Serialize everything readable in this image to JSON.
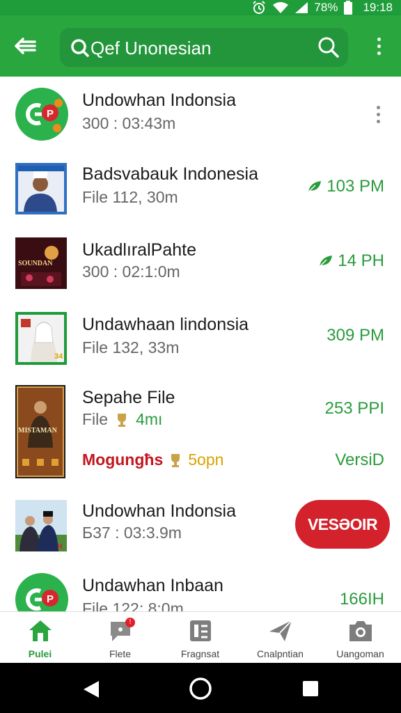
{
  "status_bar": {
    "battery": "78%",
    "time": "19:18"
  },
  "app_bar": {
    "search_text": "Qef Unonesian"
  },
  "list": [
    {
      "title": "Undowhan Indonsia",
      "subtitle": "300 : 03:43m",
      "trailing": ""
    },
    {
      "title": "Badsvabauk Indonesia",
      "subtitle": "File 112, 30m",
      "trailing": "103 PM"
    },
    {
      "title": "UkadlıralPahte",
      "subtitle": "300 : 02:1:0m",
      "trailing": "14 PH",
      "thumb_text": "SOUNDAN"
    },
    {
      "title": "Undawhaan lindonsia",
      "subtitle": "File 132, 33m",
      "trailing": "309 PM",
      "thumb_text": "34"
    },
    {
      "title": "Sepahe File",
      "subtitle_prefix": "File",
      "subtitle_value": "4mı",
      "trailing": "253 PPI",
      "extra_red": "Mogungħs",
      "extra_orange": "5opn",
      "extra_right": "VersiD",
      "thumb_text": "MISTAMAN"
    },
    {
      "title": "Undowhan Indonsia",
      "subtitle": "Б37 : 03:3.9m",
      "button": "VESƏOIR"
    },
    {
      "title": "Undawhan Inbaan",
      "subtitle": "File 122: 8:0m",
      "trailing": "166IH"
    }
  ],
  "bottom_nav": [
    {
      "label": "Pulei",
      "icon": "home-icon",
      "active": true
    },
    {
      "label": "Flete",
      "icon": "chat-bubble-icon",
      "badge": "!"
    },
    {
      "label": "Fragnsat",
      "icon": "file-icon"
    },
    {
      "label": "Cnalpntian",
      "icon": "send-icon"
    },
    {
      "label": "Uangoman",
      "icon": "camera-icon"
    }
  ],
  "colors": {
    "primary": "#2aa63f",
    "status": "#1f9d3a",
    "accent_red": "#d3222b",
    "trailing_green": "#2a9b3c"
  }
}
